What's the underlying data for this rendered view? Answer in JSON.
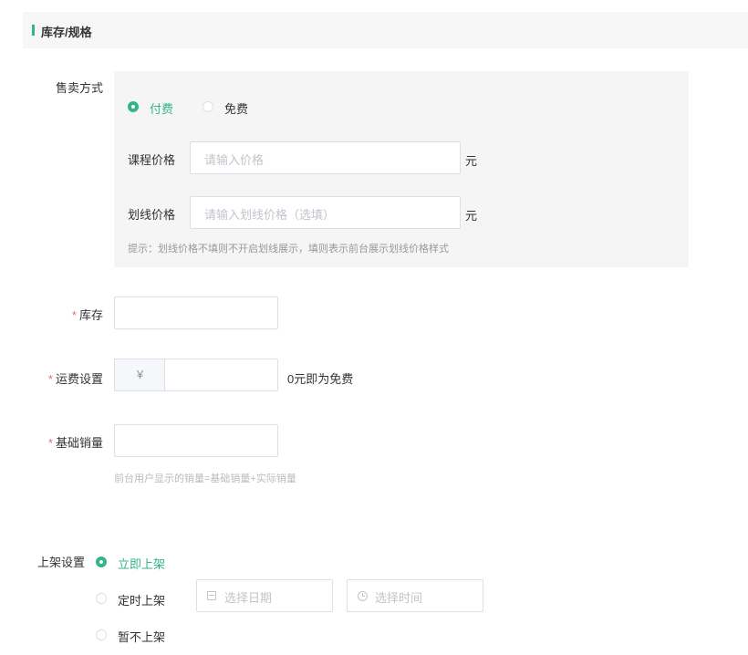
{
  "section": {
    "title": "库存/规格"
  },
  "sale_mode": {
    "label": "售卖方式",
    "options": [
      {
        "label": "付费",
        "selected": true
      },
      {
        "label": "免费",
        "selected": false
      }
    ],
    "course_price": {
      "label": "课程价格",
      "placeholder": "请输入价格",
      "unit": "元"
    },
    "strike_price": {
      "label": "划线价格",
      "placeholder": "请输入划线价格（选填）",
      "unit": "元"
    },
    "hint": "提示：划线价格不填则不开启划线展示，填则表示前台展示划线价格样式"
  },
  "stock": {
    "required_mark": "*",
    "label": "库存",
    "value": ""
  },
  "shipping": {
    "required_mark": "*",
    "label": "运费设置",
    "prefix": "¥",
    "value": "",
    "suffix": "0元即为免费"
  },
  "base_sales": {
    "required_mark": "*",
    "label": "基础销量",
    "value": "",
    "hint": "前台用户显示的销量=基础销量+实际销量"
  },
  "listing": {
    "label": "上架设置",
    "options": [
      {
        "label": "立即上架",
        "selected": true
      },
      {
        "label": "定时上架",
        "selected": false
      },
      {
        "label": "暂不上架",
        "selected": false
      }
    ],
    "date_placeholder": "选择日期",
    "time_placeholder": "选择时间"
  },
  "colors": {
    "accent": "#35b48a",
    "required": "#f56c6c"
  }
}
